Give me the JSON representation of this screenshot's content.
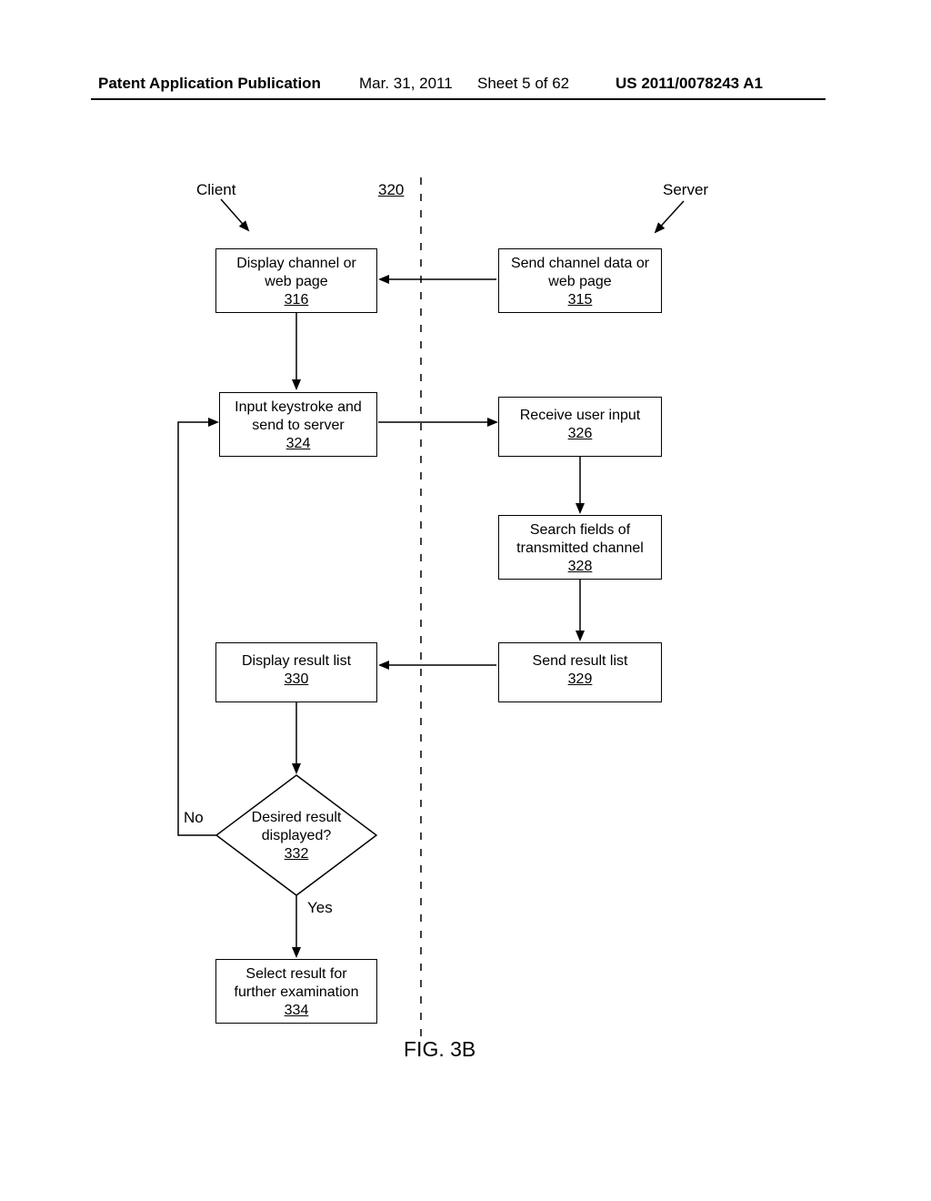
{
  "header": {
    "publication": "Patent Application Publication",
    "date": "Mar. 31, 2011",
    "sheet": "Sheet 5 of 62",
    "patent_no": "US 2011/0078243 A1"
  },
  "labels": {
    "client": "Client",
    "server": "Server",
    "ref320": "320",
    "no": "No",
    "yes": "Yes"
  },
  "boxes": {
    "b316": {
      "line1": "Display channel or",
      "line2": "web page",
      "ref": "316"
    },
    "b315": {
      "line1": "Send channel data or",
      "line2": "web page",
      "ref": "315"
    },
    "b324": {
      "line1": "Input keystroke and",
      "line2": "send to server",
      "ref": "324"
    },
    "b326": {
      "line1": "Receive user input",
      "ref": "326"
    },
    "b328": {
      "line1": "Search fields of",
      "line2": "transmitted channel",
      "ref": "328"
    },
    "b330": {
      "line1": "Display result list",
      "ref": "330"
    },
    "b329": {
      "line1": "Send result list",
      "ref": "329"
    },
    "b332": {
      "line1": "Desired result",
      "line2": "displayed?",
      "ref": "332"
    },
    "b334": {
      "line1": "Select result for",
      "line2": "further examination",
      "ref": "334"
    }
  },
  "figure": "FIG. 3B"
}
